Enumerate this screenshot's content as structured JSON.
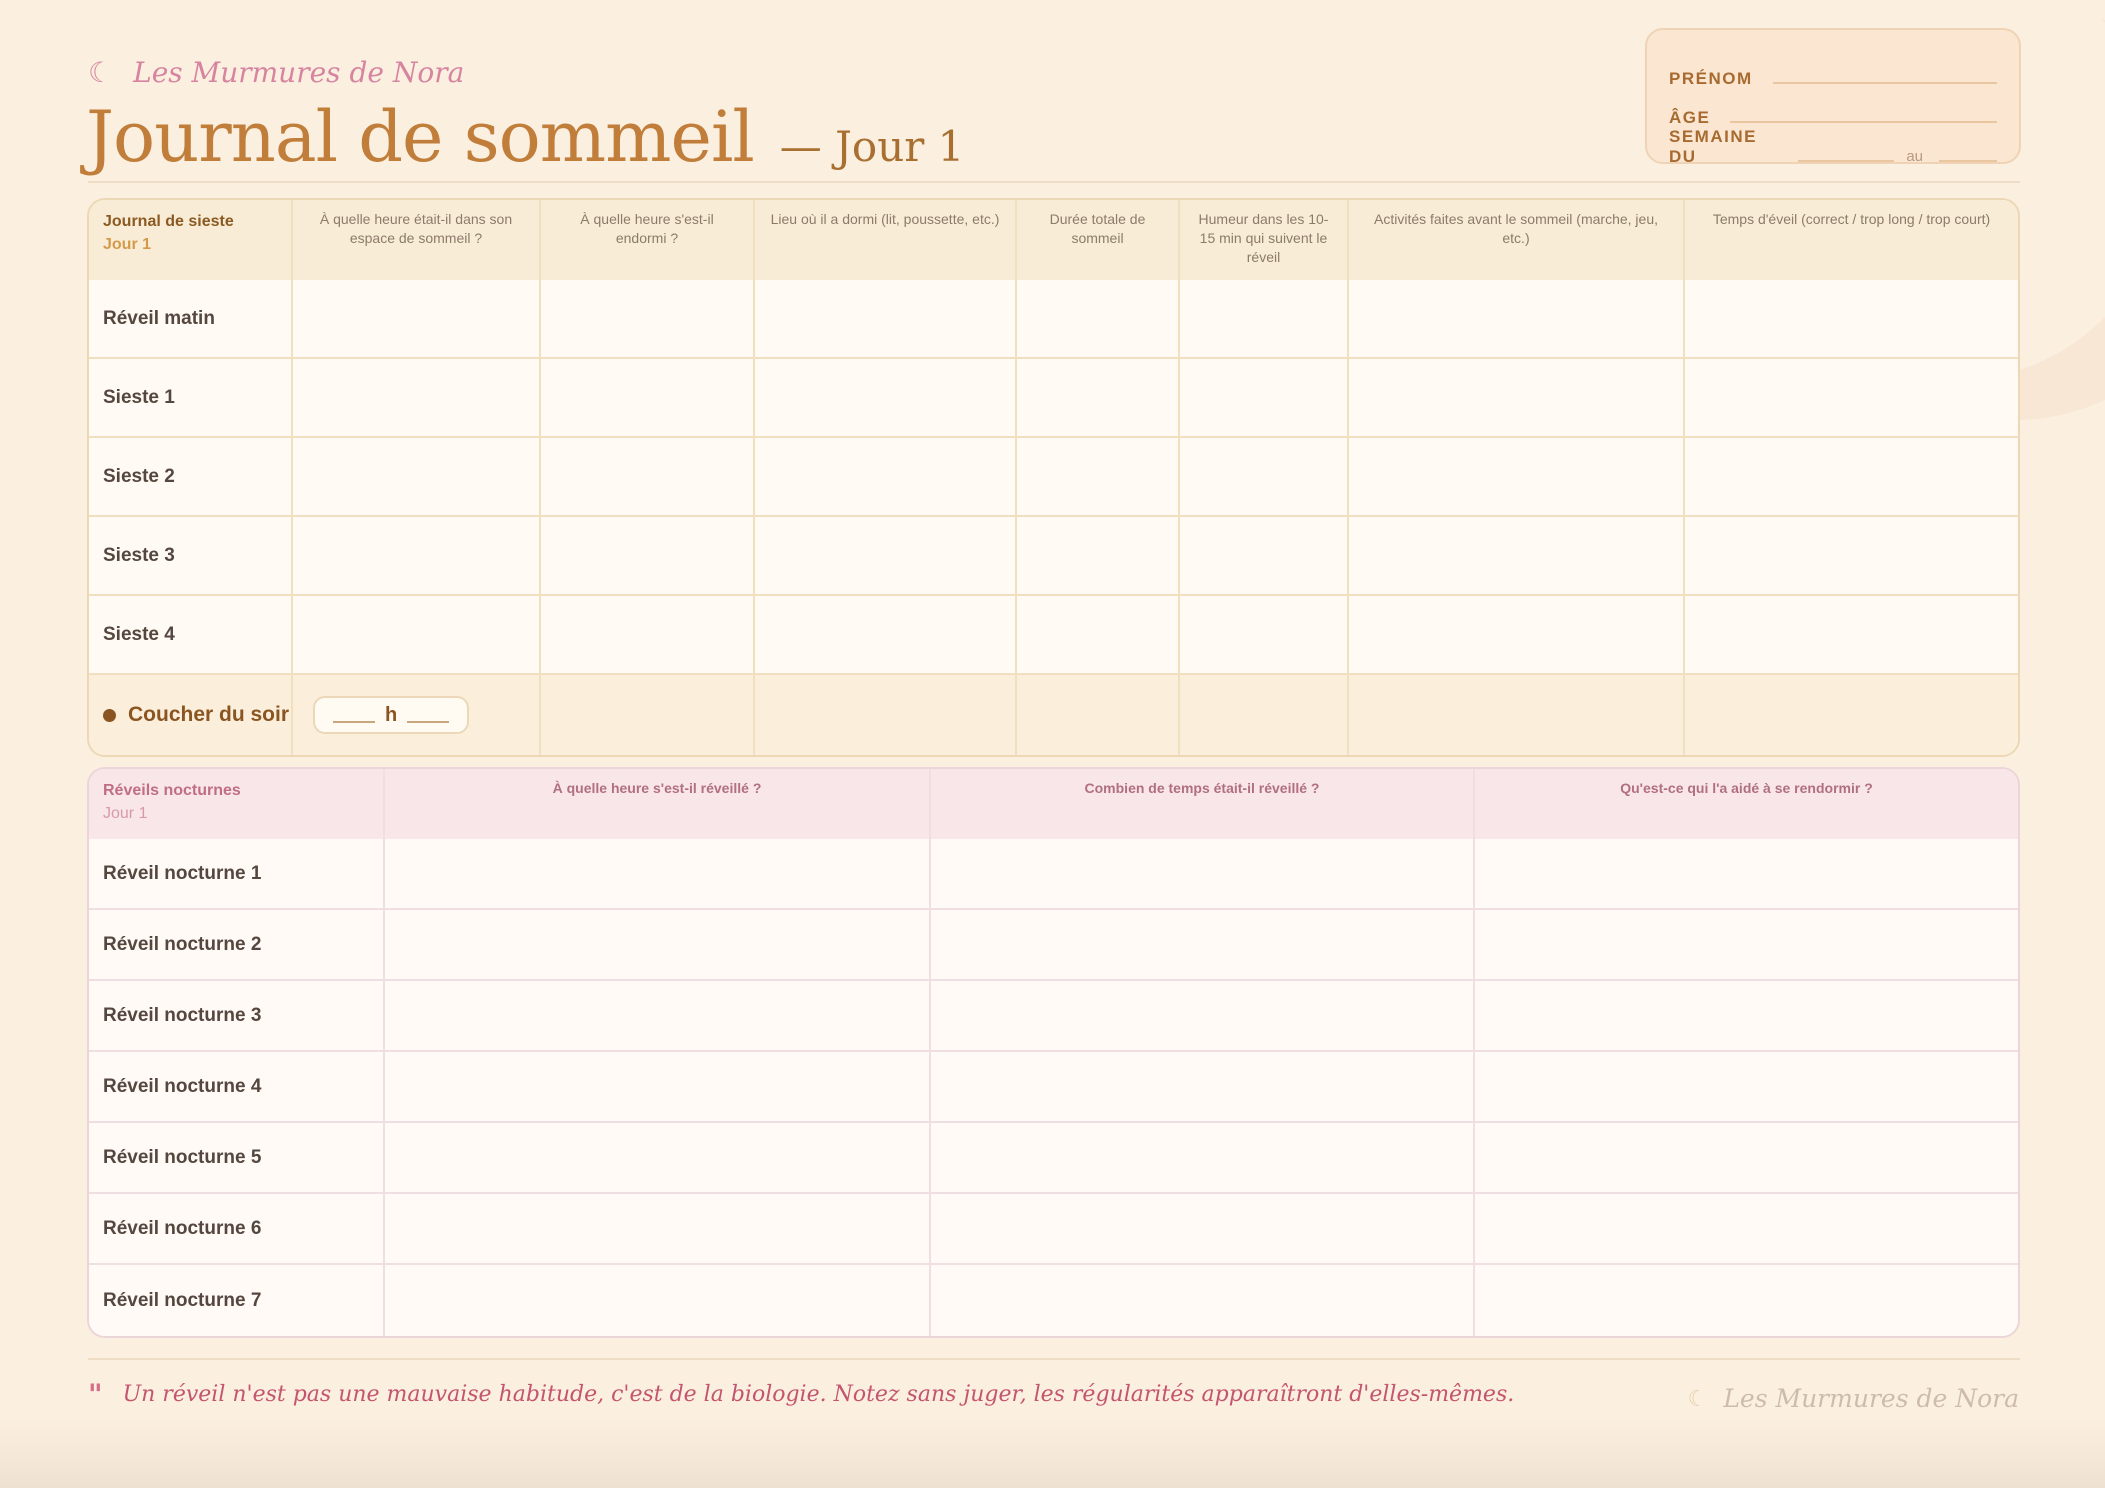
{
  "brand": {
    "moon_icon": "crescent-moon-icon",
    "name": "Les Murmures de Nora"
  },
  "header": {
    "title": "Journal de sommeil",
    "subtitle": "— Jour 1"
  },
  "identity": {
    "prenom_label": "PRÉNOM",
    "age_label": "ÂGE",
    "semaine_label": "SEMAINE DU",
    "au_label": "au"
  },
  "naps": {
    "title": "Journal de sieste",
    "day": "Jour 1",
    "columns": [
      "À quelle heure était-il dans son espace de sommeil ?",
      "À quelle heure s'est-il endormi ?",
      "Lieu où il a dormi (lit, poussette, etc.)",
      "Durée totale de sommeil",
      "Humeur dans les 10-15 min qui suivent le réveil",
      "Activités faites avant le sommeil (marche, jeu, etc.)",
      "Temps d'éveil (correct / trop long / trop court)"
    ],
    "rows": [
      "Réveil matin",
      "Sieste 1",
      "Sieste 2",
      "Sieste 3",
      "Sieste 4"
    ],
    "evening": {
      "label": "Coucher du soir",
      "hour_unit": "h"
    }
  },
  "night": {
    "title": "Réveils nocturnes",
    "day": "Jour 1",
    "columns": [
      "À quelle heure s'est-il réveillé ?",
      "Combien de temps était-il réveillé ?",
      "Qu'est-ce qui l'a aidé à se rendormir ?"
    ],
    "rows": [
      "Réveil nocturne 1",
      "Réveil nocturne 2",
      "Réveil nocturne 3",
      "Réveil nocturne 4",
      "Réveil nocturne 5",
      "Réveil nocturne 6",
      "Réveil nocturne 7"
    ]
  },
  "footer": {
    "quote_mark": "\"",
    "quote": "Un réveil n'est pas une mauvaise habitude, c'est de la biologie. Notez sans juger, les régularités apparaîtront d'elles-mêmes.",
    "brand": "Les Murmures de Nora"
  },
  "colors": {
    "accent": "#c07e3a",
    "pink": "#c4556e",
    "background": "#fbefe0"
  }
}
